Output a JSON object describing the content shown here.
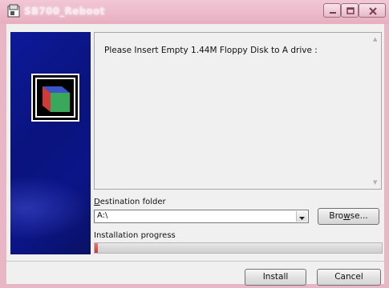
{
  "window": {
    "title": "SB700_Reboot",
    "controls": [
      "minimize-icon",
      "maximize-icon",
      "close-icon"
    ]
  },
  "message": {
    "text": "Please Insert Empty 1.44M Floppy Disk to A drive :"
  },
  "destination": {
    "label_accesskey": "D",
    "label_rest": "estination folder",
    "value": "A:\\"
  },
  "buttons": {
    "browse_pre": "Bro",
    "browse_key": "w",
    "browse_post": "se...",
    "install": "Install",
    "cancel": "Cancel"
  },
  "progress": {
    "label": "Installation progress",
    "fraction": 0.01
  },
  "colors": {
    "banner": "#0b1588",
    "progress_fill": "#d04545"
  }
}
